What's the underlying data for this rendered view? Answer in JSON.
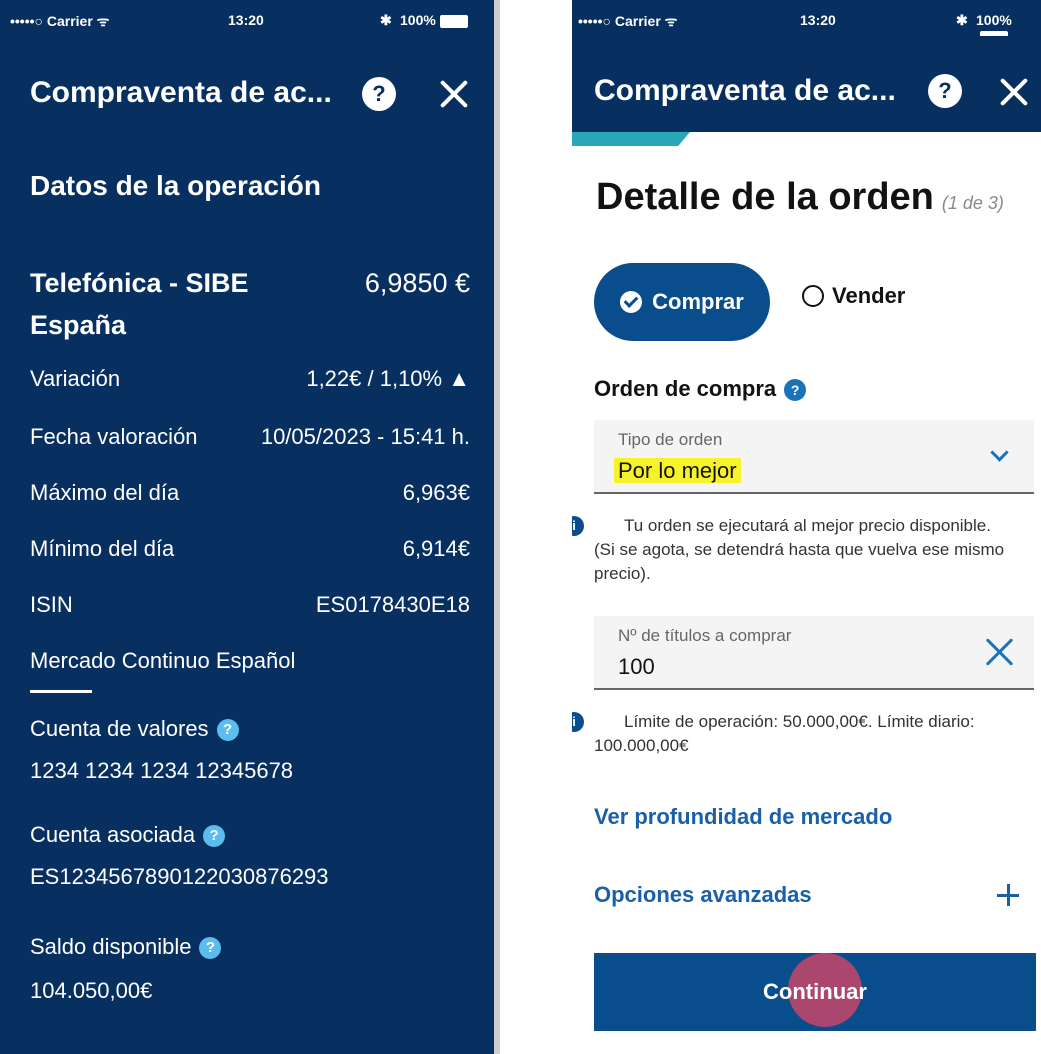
{
  "left": {
    "status": {
      "carrier": "•••••○ Carrier ᯤ",
      "time": "13:20",
      "battery": "100%"
    },
    "title": "Compraventa de ac...",
    "section": "Datos de la operación",
    "stock": {
      "name_line1": "Telefónica - SIBE",
      "name_line2": "España",
      "price": "6,9850 €"
    },
    "rows": [
      {
        "label": "Variación",
        "value": "1,22€ / 1,10% ▲"
      },
      {
        "label": "Fecha valoración",
        "value": "10/05/2023 - 15:41 h."
      },
      {
        "label": "Máximo del día",
        "value": "6,963€"
      },
      {
        "label": "Mínimo del día",
        "value": "6,914€"
      },
      {
        "label": "ISIN",
        "value": "ES0178430E18"
      }
    ],
    "market": "Mercado Continuo Español",
    "cuenta_valores": {
      "label": "Cuenta de valores",
      "value": "1234 1234 1234 12345678"
    },
    "cuenta_asociada": {
      "label": "Cuenta asociada",
      "value": "ES1234567890122030876293"
    },
    "saldo": {
      "label": "Saldo disponible",
      "value": "104.050,00€"
    },
    "help_icon": "?"
  },
  "right": {
    "status": {
      "carrier": "•••••○ Carrier ᯤ",
      "time": "13:20",
      "battery": "100%"
    },
    "title": "Compraventa de ac...",
    "heading": "Detalle de la orden",
    "step": "(1 de 3)",
    "buy_label": "Comprar",
    "sell_label": "Vender",
    "order_section": "Orden de compra",
    "tipo_orden": {
      "label": "Tipo de orden",
      "value": "Por lo mejor"
    },
    "tipo_note": "Tu orden se ejecutará al mejor precio disponible. (Si se agota, se detendrá hasta que vuelva ese mismo precio).",
    "titulos": {
      "label": "Nº de títulos a comprar",
      "value": "100"
    },
    "titulos_note": "Límite de operación: 50.000,00€. Límite diario: 100.000,00€",
    "link_profundidad": "Ver profundidad de mercado",
    "opciones": "Opciones avanzadas",
    "continue": "Continuar",
    "help_icon": "?",
    "info_icon": "i"
  },
  "colors": {
    "navy": "#072f5f",
    "primary": "#0a4d8c",
    "link": "#1a5fa8",
    "highlight": "#f7f32a",
    "accent": "#2aa8b8",
    "info": "#5bbcf0"
  }
}
